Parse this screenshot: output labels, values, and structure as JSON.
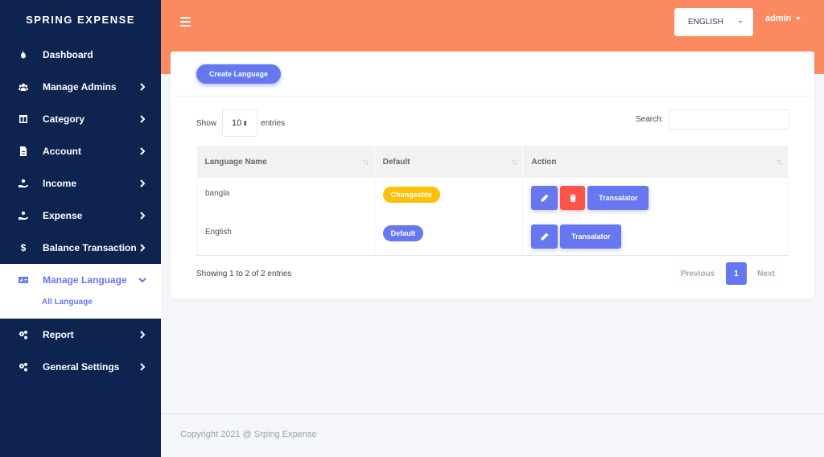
{
  "brand": "SPRING EXPENSE",
  "sidebar": {
    "items": [
      {
        "label": "Dashboard",
        "icon": "fire-icon"
      },
      {
        "label": "Manage Admins",
        "icon": "users-icon"
      },
      {
        "label": "Category",
        "icon": "columns-icon"
      },
      {
        "label": "Account",
        "icon": "file-icon"
      },
      {
        "label": "Income",
        "icon": "hand-holding-icon"
      },
      {
        "label": "Expense",
        "icon": "hand-holding-icon"
      },
      {
        "label": "Balance Transaction",
        "icon": "dollar-icon"
      },
      {
        "label": "Manage Language",
        "icon": "language-icon",
        "active": true
      },
      {
        "label": "Report",
        "icon": "cogs-icon"
      },
      {
        "label": "General Settings",
        "icon": "cogs-icon"
      }
    ],
    "subitem": "All Language"
  },
  "header": {
    "language": "ENGLISH",
    "user": "admin"
  },
  "toolbar": {
    "create_label": "Create Language"
  },
  "datatable": {
    "show_label": "Show",
    "entries_value": "10",
    "entries_label": "entries",
    "search_label": "Search:",
    "columns": [
      "Language Name",
      "Default",
      "Action"
    ],
    "rows": [
      {
        "name": "bangla",
        "badge": "Changeable",
        "translate": "Transalator"
      },
      {
        "name": "English",
        "badge": "Default",
        "translate": "Transalator"
      }
    ],
    "info": "Showing 1 to 2 of 2 entries",
    "pagination": {
      "previous": "Previous",
      "page": "1",
      "next": "Next"
    }
  },
  "footer": "Copyright 2021 @ Srping Expense",
  "colors": {
    "sidebar": "#0d2451",
    "topbar": "#fc8a61",
    "primary": "#6777ef",
    "warning": "#ffc107",
    "danger": "#fc544b"
  }
}
